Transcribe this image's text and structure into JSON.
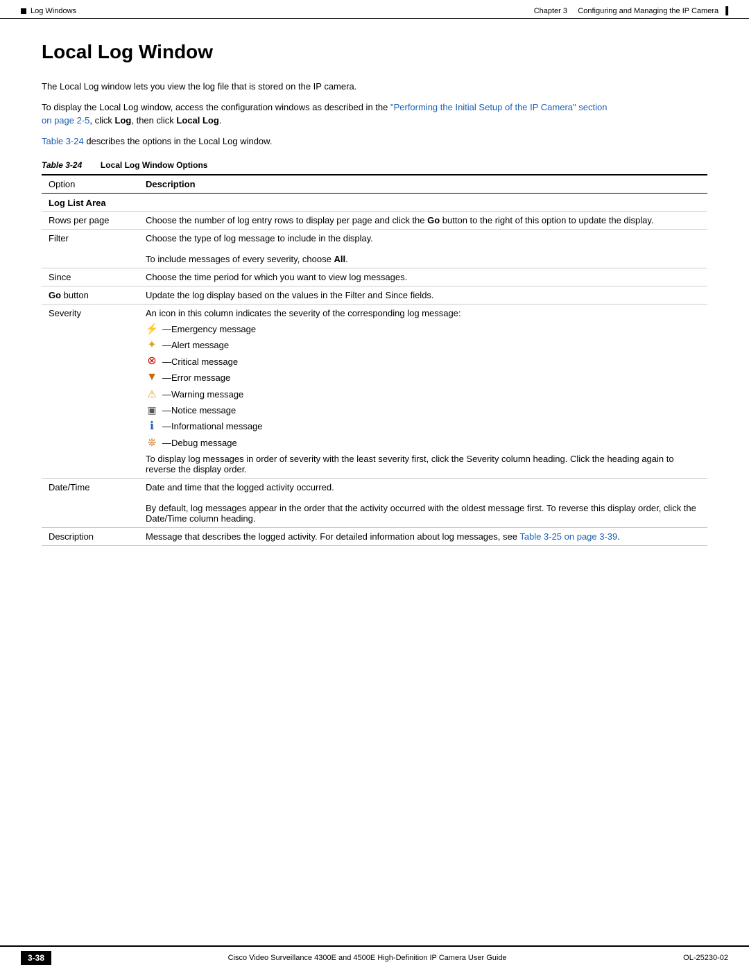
{
  "header": {
    "left_marker": "■",
    "left_text": "Log Windows",
    "right_chapter": "Chapter 3",
    "right_title": "Configuring and Managing the IP Camera",
    "right_marker": "▐"
  },
  "page_title": "Local Log Window",
  "paragraphs": [
    {
      "id": "p1",
      "text_plain": "The Local Log window lets you view the log file that is stored on the IP camera."
    },
    {
      "id": "p2",
      "text_before": "To display the Local Log window, access the configuration windows as described in the ",
      "link_text": "\"Performing the Initial Setup of the IP Camera\" section on page 2-5",
      "text_after": ", click ",
      "bold1": "Log",
      "text_mid": ", then click ",
      "bold2": "Local Log",
      "text_end": "."
    },
    {
      "id": "p3",
      "link_text": "Table 3-24",
      "text_after": " describes the options in the Local Log window."
    }
  ],
  "table_caption": {
    "label": "Table 3-24",
    "title": "Local Log Window Options"
  },
  "table_headers": {
    "option": "Option",
    "description": "Description"
  },
  "table_section": "Log List Area",
  "table_rows": [
    {
      "option": "Rows per page",
      "description": "Choose the number of log entry rows to display per page and click the Go button to the right of this option to update the display.",
      "has_bold": true,
      "bold_word": "Go"
    },
    {
      "option": "Filter",
      "description_lines": [
        "Choose the type of log message to include in the display.",
        "To include messages of every severity, choose All."
      ],
      "has_bold_second": true,
      "bold_word": "All"
    },
    {
      "option": "Since",
      "description": "Choose the time period for which you want to view log messages."
    },
    {
      "option": "Go button",
      "option_bold": "Go",
      "description": "Update the log display based on the values in the Filter and Since fields."
    },
    {
      "option": "Severity",
      "has_severity_list": true,
      "description_before": "An icon in this column indicates the severity of the corresponding log message:",
      "severity_items": [
        {
          "icon": "⚡",
          "label": "—Emergency message",
          "symbol": "emergency"
        },
        {
          "icon": "✦",
          "label": "—Alert message",
          "symbol": "alert"
        },
        {
          "icon": "🚫",
          "label": "—Critical message",
          "symbol": "critical"
        },
        {
          "icon": "▼",
          "label": "—Error message",
          "symbol": "error"
        },
        {
          "icon": "⚠",
          "label": "—Warning message",
          "symbol": "warning"
        },
        {
          "icon": "📋",
          "label": "—Notice message",
          "symbol": "notice"
        },
        {
          "icon": "ℹ",
          "label": "—Informational message",
          "symbol": "info"
        },
        {
          "icon": "❊",
          "label": "—Debug message",
          "symbol": "debug"
        }
      ],
      "description_after": "To display log messages in order of severity with the least severity first, click the Severity column heading. Click the heading again to reverse the display order."
    },
    {
      "option": "Date/Time",
      "description_lines": [
        "Date and time that the logged activity occurred.",
        "By default, log messages appear in the order that the activity occurred with the oldest message first. To reverse this display order, click the Date/Time column heading."
      ]
    },
    {
      "option": "Description",
      "description_before": "Message that describes the logged activity. For detailed information about log messages, see ",
      "link_text": "Table 3-25 on page 3-39",
      "description_after": "."
    }
  ],
  "footer": {
    "page_num": "3-38",
    "center_text": "Cisco Video Surveillance 4300E and 4500E High-Definition IP Camera User Guide",
    "right_text": "OL-25230-02"
  }
}
